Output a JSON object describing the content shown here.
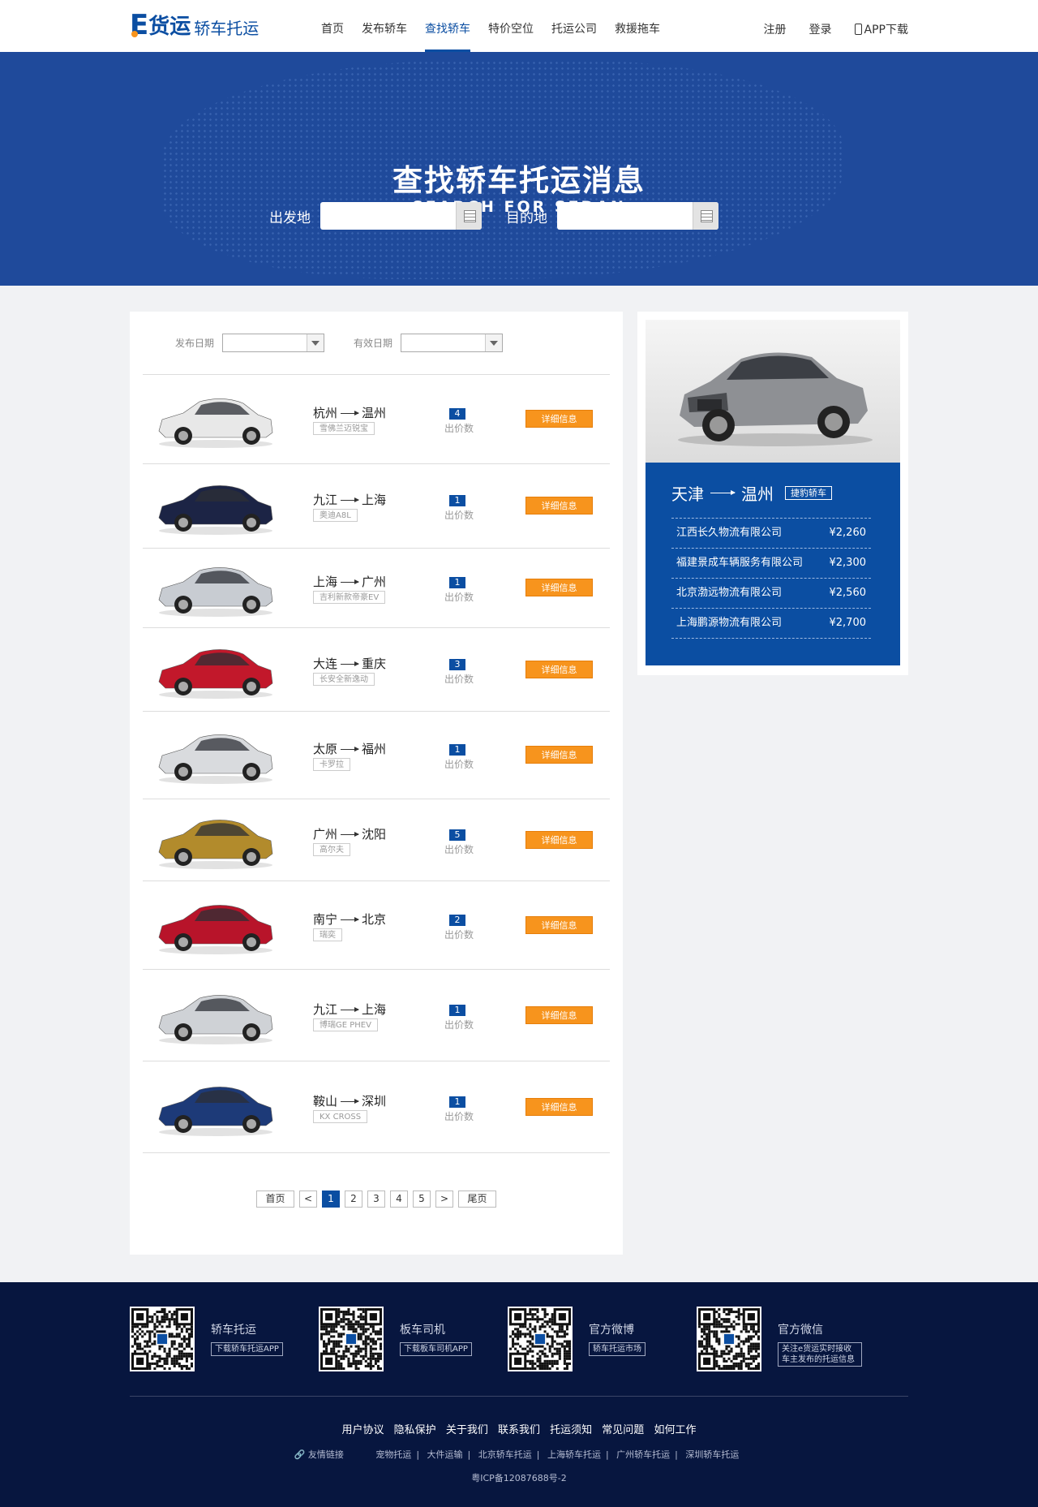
{
  "logo": {
    "brand": "货运",
    "sub": "轿车托运"
  },
  "nav": [
    "首页",
    "发布轿车",
    "查找轿车",
    "特价空位",
    "托运公司",
    "救援拖车"
  ],
  "header_right": {
    "register": "注册",
    "login": "登录",
    "app": "APP下载"
  },
  "banner": {
    "title": "查找轿车托运消息",
    "subtitle": "SEARCH FOR SEDAN",
    "from_label": "出发地",
    "to_label": "目的地",
    "from_value": "",
    "to_value": ""
  },
  "filters": {
    "publish_label": "发布日期",
    "valid_label": "有效日期"
  },
  "listings": [
    {
      "from": "杭州",
      "to": "温州",
      "model": "雪佛兰迈锐宝",
      "count": "4",
      "count_label": "出价数",
      "detail": "详细信息",
      "color": "#e8e8e8"
    },
    {
      "from": "九江",
      "to": "上海",
      "model": "奥迪A8L",
      "count": "1",
      "count_label": "出价数",
      "detail": "详细信息",
      "color": "#1c2445"
    },
    {
      "from": "上海",
      "to": "广州",
      "model": "吉利新款帝豪EV",
      "count": "1",
      "count_label": "出价数",
      "detail": "详细信息",
      "color": "#c8ccd2"
    },
    {
      "from": "大连",
      "to": "重庆",
      "model": "长安全新逸动",
      "count": "3",
      "count_label": "出价数",
      "detail": "详细信息",
      "color": "#c2182b"
    },
    {
      "from": "太原",
      "to": "福州",
      "model": "卡罗拉",
      "count": "1",
      "count_label": "出价数",
      "detail": "详细信息",
      "color": "#d9dbde"
    },
    {
      "from": "广州",
      "to": "沈阳",
      "model": "高尔夫",
      "count": "5",
      "count_label": "出价数",
      "detail": "详细信息",
      "color": "#b28b2c"
    },
    {
      "from": "南宁",
      "to": "北京",
      "model": "瑞奕",
      "count": "2",
      "count_label": "出价数",
      "detail": "详细信息",
      "color": "#b8142a"
    },
    {
      "from": "九江",
      "to": "上海",
      "model": "博瑞GE PHEV",
      "count": "1",
      "count_label": "出价数",
      "detail": "详细信息",
      "color": "#cfd2d6"
    },
    {
      "from": "鞍山",
      "to": "深圳",
      "model": "KX CROSS",
      "count": "1",
      "count_label": "出价数",
      "detail": "详细信息",
      "color": "#1d3a78"
    }
  ],
  "pager": {
    "first": "首页",
    "prev": "<",
    "pages": [
      "1",
      "2",
      "3",
      "4",
      "5"
    ],
    "next": ">",
    "last": "尾页",
    "current": "1"
  },
  "featured": {
    "from": "天津",
    "to": "温州",
    "tag": "捷豹轿车",
    "quotes": [
      {
        "company": "江西长久物流有限公司",
        "price": "¥2,260"
      },
      {
        "company": "福建景成车辆服务有限公司",
        "price": "¥2,300"
      },
      {
        "company": "北京渤远物流有限公司",
        "price": "¥2,560"
      },
      {
        "company": "上海鹏源物流有限公司",
        "price": "¥2,700"
      }
    ]
  },
  "footer": {
    "qrs": [
      {
        "title": "轿车托运",
        "button": "下载轿车托运APP"
      },
      {
        "title": "板车司机",
        "button": "下载板车司机APP"
      },
      {
        "title": "官方微博",
        "button": "轿车托运市场"
      },
      {
        "title": "官方微信",
        "button": "关注e货运实时接收车主发布的托运信息"
      }
    ],
    "links": [
      "用户协议",
      "隐私保护",
      "关于我们",
      "联系我们",
      "托运须知",
      "常见问题",
      "如何工作"
    ],
    "friend_label": "友情链接",
    "friend_links": [
      "宠物托运",
      "大件运输",
      "北京轿车托运",
      "上海轿车托运",
      "广州轿车托运",
      "深圳轿车托运"
    ],
    "icp": "粤ICP备12087688号-2"
  }
}
